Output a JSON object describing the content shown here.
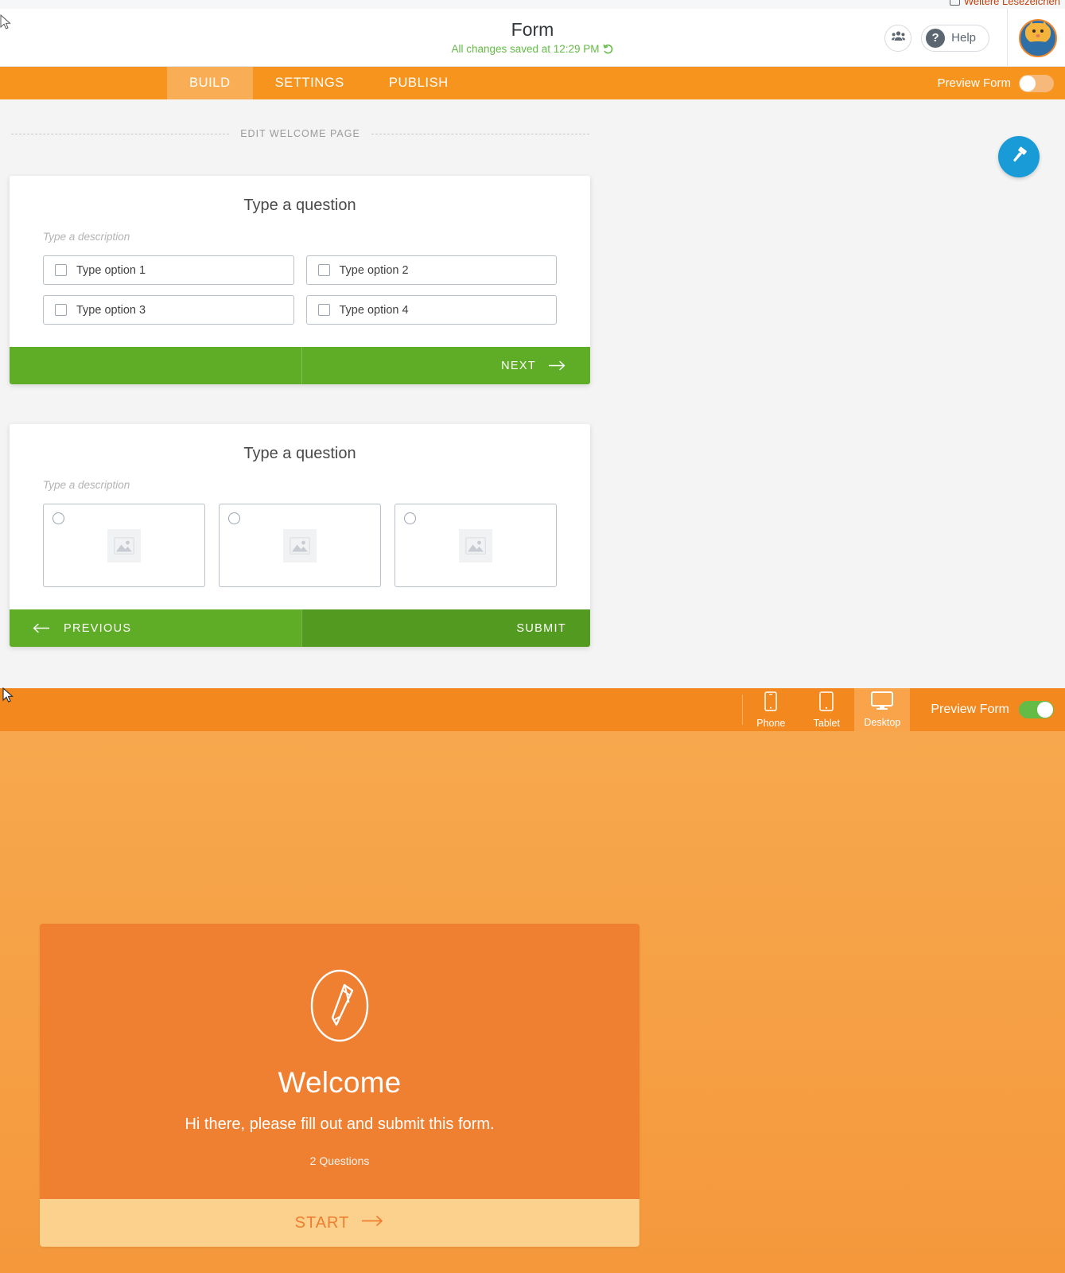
{
  "browser": {
    "other_bookmarks": "Weitere Lesezeichen"
  },
  "header": {
    "title": "Form",
    "saved_status": "All changes saved at 12:29 PM",
    "collaborators_icon": "people-icon",
    "help_label": "Help",
    "help_icon": "question-mark-icon",
    "undo_icon": "undo-icon",
    "avatar_icon": "cat-avatar"
  },
  "navbar": {
    "tabs": [
      {
        "label": "BUILD",
        "active": true
      },
      {
        "label": "SETTINGS",
        "active": false
      },
      {
        "label": "PUBLISH",
        "active": false
      }
    ],
    "preview_label": "Preview Form",
    "preview_enabled": false
  },
  "canvas": {
    "edit_welcome_label": "EDIT WELCOME PAGE",
    "theme_fab_icon": "paint-roller-icon",
    "accent_blue": "#189bd7"
  },
  "cards": [
    {
      "title": "Type a question",
      "description": "Type a description",
      "type": "checkbox",
      "options": [
        "Type option 1",
        "Type option 2",
        "Type option 3",
        "Type option 4"
      ],
      "footer": {
        "next_label": "NEXT",
        "next_arrow_icon": "arrow-right-icon"
      }
    },
    {
      "title": "Type a question",
      "description": "Type a description",
      "type": "image-radio",
      "image_options": [
        {
          "placeholder_icon": "image-placeholder-icon"
        },
        {
          "placeholder_icon": "image-placeholder-icon"
        },
        {
          "placeholder_icon": "image-placeholder-icon"
        }
      ],
      "footer": {
        "previous_label": "PREVIOUS",
        "previous_arrow_icon": "arrow-left-icon",
        "submit_label": "SUBMIT"
      }
    }
  ],
  "devicebar": {
    "devices": [
      {
        "label": "Phone",
        "icon": "phone-icon",
        "active": false
      },
      {
        "label": "Tablet",
        "icon": "tablet-icon",
        "active": false
      },
      {
        "label": "Desktop",
        "icon": "desktop-icon",
        "active": true
      }
    ],
    "preview_label": "Preview Form",
    "preview_enabled": true
  },
  "preview": {
    "icon": "pencil-circle-icon",
    "heading": "Welcome",
    "subtitle": "Hi there, please fill out and submit this form.",
    "question_count": "2 Questions",
    "start_label": "START",
    "start_arrow_icon": "arrow-right-icon",
    "colors": {
      "card_bg": "#ef7f31",
      "start_bg": "#fcd08d",
      "start_text": "#ee7e2e",
      "page_bg": "#f7a84e"
    }
  },
  "colors": {
    "brand_orange": "#f7941e",
    "green_button": "#5fad27",
    "green_button_dark": "#539b20",
    "saved_green": "#64bb46"
  }
}
